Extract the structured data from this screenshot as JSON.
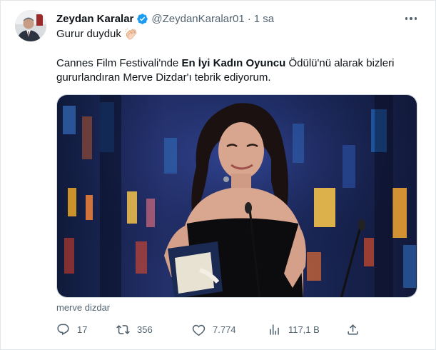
{
  "tweet": {
    "author_name": "Zeydan Karalar",
    "handle": "@ZeydanKaralar01",
    "dot": "·",
    "time": "1 sa",
    "line1": "Gurur duyduk",
    "para_part1": "Cannes Film Festivali'nde ",
    "para_bold": "En İyi Kadın Oyuncu",
    "para_part2": " Ödülü'nü alarak bizleri gururlandıran Merve Dizdar'ı tebrik ediyorum.",
    "media_caption": "merve dizdar"
  },
  "actions": {
    "reply_count": "17",
    "retweet_count": "356",
    "like_count": "7.774",
    "view_count": "117,1 B"
  },
  "icons": {
    "verified": "verified-badge-icon",
    "more": "more-options-icon",
    "clap": "clapping-hands-emoji-icon",
    "reply": "reply-icon",
    "retweet": "retweet-icon",
    "like": "heart-icon",
    "views": "views-chart-icon",
    "share": "share-icon"
  },
  "colors": {
    "verified_blue": "#1d9bf0",
    "muted_text": "#536471",
    "primary_text": "#0f1419"
  }
}
